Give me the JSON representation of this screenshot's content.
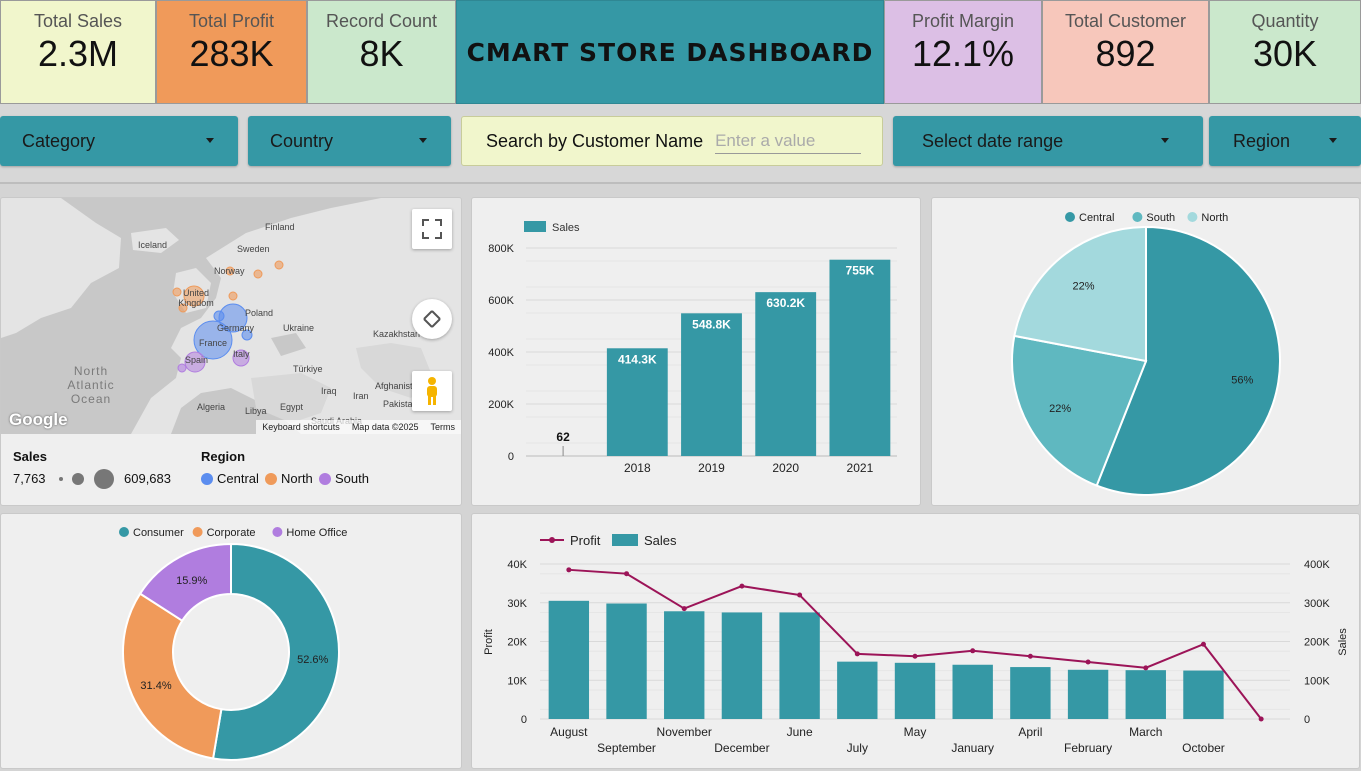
{
  "kpis": {
    "total_sales": {
      "label": "Total Sales",
      "value": "2.3M",
      "bg": "#f1f6cc"
    },
    "total_profit": {
      "label": "Total Profit",
      "value": "283K",
      "bg": "#f09a5a"
    },
    "record_count": {
      "label": "Record Count",
      "value": "8K",
      "bg": "#cbe8cc"
    },
    "profit_margin": {
      "label": "Profit Margin",
      "value": "12.1%",
      "bg": "#dcbfe5"
    },
    "total_customer": {
      "label": "Total Customer",
      "value": "892",
      "bg": "#f7c7bb"
    },
    "quantity": {
      "label": "Quantity",
      "value": "30K",
      "bg": "#cbe8cc"
    }
  },
  "title": "CMART STORE DASHBOARD",
  "filters": {
    "category": "Category",
    "country": "Country",
    "search_label": "Search by Customer Name",
    "search_placeholder": "Enter a value",
    "date_range": "Select date range",
    "region": "Region"
  },
  "map": {
    "labels": {
      "finland": "Finland",
      "iceland": "Iceland",
      "sweden": "Sweden",
      "norway": "Norway",
      "uk": "United Kingdom",
      "poland": "Poland",
      "germany": "Germany",
      "ukraine": "Ukraine",
      "france": "France",
      "spain": "Spain",
      "italy": "Italy",
      "turkiye": "Türkiye",
      "kazakhstan": "Kazakhstan",
      "iraq": "Iraq",
      "iran": "Iran",
      "afghanistan": "Afghanistan",
      "pakistan": "Pakista",
      "algeria": "Algeria",
      "libya": "Libya",
      "egypt": "Egypt",
      "saudi": "Saudi Arabia"
    },
    "ocean": "North Atlantic Ocean",
    "logo": "Google",
    "footer": {
      "shortcuts": "Keyboard shortcuts",
      "data": "Map data ©2025",
      "terms": "Terms"
    },
    "legend": {
      "size_title": "Sales",
      "size_min": "7,763",
      "size_max": "609,683",
      "color_title": "Region",
      "central": "Central",
      "north": "North",
      "south": "South"
    },
    "colors": {
      "central": "#5b8def",
      "north": "#ef9a5a",
      "south": "#b07ddf"
    }
  },
  "chart_data": [
    {
      "type": "bar",
      "title": "",
      "legend": [
        "Sales"
      ],
      "categories": [
        "",
        "2018",
        "2019",
        "2020",
        "2021"
      ],
      "values": [
        62,
        414300,
        548800,
        630200,
        755000
      ],
      "data_labels": [
        "62",
        "414.3K",
        "548.8K",
        "630.2K",
        "755K"
      ],
      "y_ticks": [
        "0",
        "200K",
        "400K",
        "600K",
        "800K"
      ],
      "ylim": [
        0,
        800000
      ],
      "color": "#3598a5"
    },
    {
      "type": "pie",
      "legend": [
        "Central",
        "South",
        "North"
      ],
      "values": [
        56,
        22,
        22
      ],
      "labels": [
        "56%",
        "22%",
        "22%"
      ],
      "colors": [
        "#3598a5",
        "#5fb8c0",
        "#a3d9dd"
      ]
    },
    {
      "type": "pie",
      "donut": true,
      "legend": [
        "Consumer",
        "Corporate",
        "Home Office"
      ],
      "values": [
        52.6,
        31.4,
        15.9
      ],
      "labels": [
        "52.6%",
        "31.4%",
        "15.9%"
      ],
      "colors": [
        "#3598a5",
        "#f09a5a",
        "#b07ddf"
      ]
    },
    {
      "type": "bar",
      "combo": "bar+line",
      "legend": [
        "Profit",
        "Sales"
      ],
      "categories": [
        "August",
        "September",
        "November",
        "December",
        "June",
        "July",
        "May",
        "January",
        "April",
        "February",
        "March",
        "October",
        ""
      ],
      "sales": [
        305000,
        298000,
        278000,
        275000,
        275000,
        148000,
        145000,
        140000,
        134000,
        127000,
        126000,
        125000,
        null
      ],
      "profit": [
        38500,
        37500,
        28500,
        34300,
        32000,
        16800,
        16200,
        17600,
        16200,
        14700,
        13200,
        19300,
        0
      ],
      "ylabel_left": "Profit",
      "ylabel_right": "Sales",
      "y_left_ticks": [
        "0",
        "10K",
        "20K",
        "30K",
        "40K"
      ],
      "y_right_ticks": [
        "0",
        "100K",
        "200K",
        "300K",
        "400K"
      ],
      "ylim_left": [
        0,
        40000
      ],
      "ylim_right": [
        0,
        400000
      ],
      "bar_color": "#3598a5",
      "line_color": "#9c1458"
    }
  ]
}
